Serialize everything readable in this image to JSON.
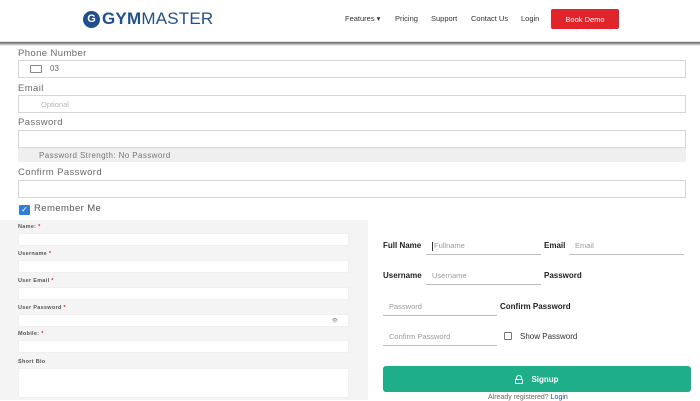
{
  "header": {
    "logo_letter": "G",
    "logo_gym": "GYM",
    "logo_master": "MASTER",
    "nav": {
      "features": "Features ▾",
      "pricing": "Pricing",
      "support": "Support",
      "contact": "Contact Us",
      "login": "Login"
    },
    "book_demo": "Book Demo"
  },
  "top_form": {
    "phone_label": "Phone Number",
    "phone_value": "03",
    "email_label": "Email",
    "email_placeholder": "Optional",
    "password_label": "Password",
    "password_strength": "Password Strength: No Password",
    "confirm_label": "Confirm Password",
    "remember_label": "Remember Me",
    "remember_checked": true
  },
  "left_form": {
    "name_label": "Name:",
    "username_label": "Username",
    "email_label": "User Email",
    "password_label": "User Password",
    "password_toggle": "👁",
    "mobile_label": "Mobile:",
    "bio_label": "Short Bio",
    "required_mark": "*"
  },
  "right_form": {
    "fullname_label": "Full Name",
    "fullname_placeholder": "Fullname",
    "email_label": "Email",
    "email_placeholder": "Email",
    "username_label": "Username",
    "username_placeholder": "Username",
    "password_label": "Password",
    "password_placeholder": "Password",
    "confirm_label": "Confirm Password",
    "confirm_placeholder": "Confirm Password",
    "show_password_label": "Show Password",
    "signup_label": "Signup",
    "already_text": "Already registered?",
    "login_link": "Login"
  },
  "colors": {
    "brand_blue": "#1f4f8f",
    "demo_red": "#e1232a",
    "signup_green": "#1fae8a",
    "checkbox_blue": "#2f7fd6"
  }
}
